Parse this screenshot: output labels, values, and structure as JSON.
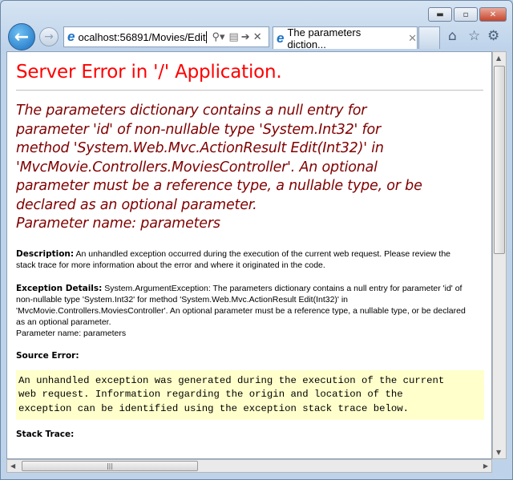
{
  "browser": {
    "address": "ocalhost:56891/Movies/Edit",
    "tab_title": "The parameters diction...",
    "icons": [
      "back-icon",
      "forward-icon",
      "search-icon",
      "compatibility-icon",
      "go-icon",
      "stop-icon",
      "close-tab-icon",
      "home-icon",
      "favorites-icon",
      "settings-icon"
    ]
  },
  "page": {
    "title": "Server Error in '/' Application.",
    "message_lines": [
      "The parameters dictionary contains a null entry for",
      "parameter 'id' of non-nullable type 'System.Int32' for",
      "method 'System.Web.Mvc.ActionResult Edit(Int32)' in",
      "'MvcMovie.Controllers.MoviesController'. An optional",
      "parameter must be a reference type, a nullable type, or be",
      "declared as an optional parameter.",
      "Parameter name: parameters"
    ],
    "description_label": "Description:",
    "description_lines": [
      "An unhandled exception occurred during the execution of the current web request. Please review the",
      "stack trace for more information about the error and where it originated in the code."
    ],
    "exception_label": "Exception Details:",
    "exception_lines": [
      "System.ArgumentException: The parameters dictionary contains a null entry for parameter 'id' of",
      "non-nullable type 'System.Int32' for method 'System.Web.Mvc.ActionResult Edit(Int32)' in",
      "'MvcMovie.Controllers.MoviesController'. An optional parameter must be a reference type, a nullable type, or be declared",
      "as an optional parameter.",
      "Parameter name: parameters"
    ],
    "source_error_label": "Source Error:",
    "source_error_lines": [
      "An unhandled exception was generated during the execution of the current",
      "web request. Information regarding the origin and location of the",
      "exception can be identified using the exception stack trace below."
    ],
    "stack_trace_label": "Stack Trace:"
  },
  "colors": {
    "title": "#ff0000",
    "message": "#800000",
    "code_bg": "#ffffcc"
  }
}
